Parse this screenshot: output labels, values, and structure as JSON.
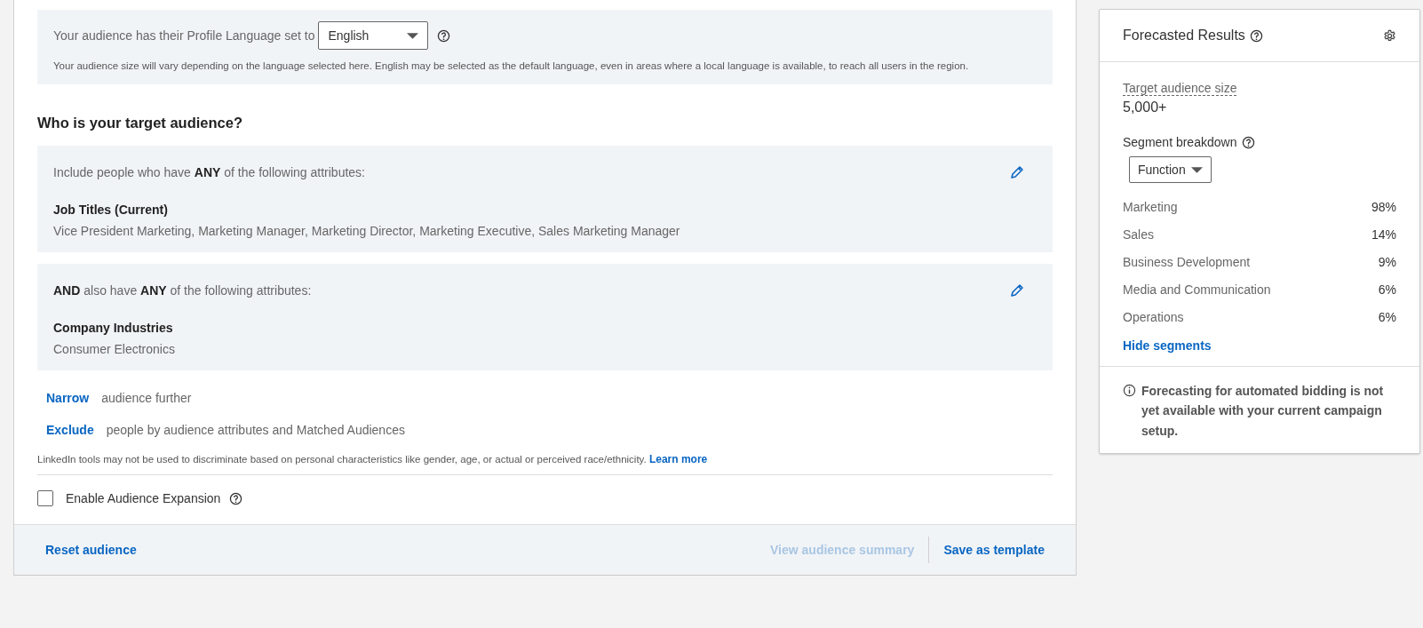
{
  "language": {
    "label": "Your audience has their Profile Language set to",
    "value": "English",
    "note": "Your audience size will vary depending on the language selected here. English may be selected as the default language, even in areas where a local language is available, to reach all users in the region."
  },
  "audience": {
    "heading": "Who is your target audience?",
    "groups": [
      {
        "intro": "Include people who have **ANY** of the following attributes:",
        "title": "Job Titles (Current)",
        "values": "Vice President Marketing, Marketing Manager, Marketing Director, Marketing Executive, Sales Marketing Manager"
      },
      {
        "intro": "**AND** also have **ANY** of the following attributes:",
        "title": "Company Industries",
        "values": "Consumer Electronics"
      }
    ],
    "actions": [
      {
        "link": "Narrow",
        "text": "audience further"
      },
      {
        "link": "Exclude",
        "text": "people by audience attributes and Matched Audiences"
      }
    ],
    "disclaimer": "LinkedIn tools may not be used to discriminate based on personal characteristics like gender, age, or actual or perceived race/ethnicity.",
    "disclaimer_link": "Learn more",
    "expansion": {
      "label": "Enable Audience Expansion",
      "checked": false
    }
  },
  "footer": {
    "reset": "Reset audience",
    "buttons": [
      {
        "label": "View audience summary",
        "disabled": true
      },
      {
        "label": "Save as template",
        "disabled": false
      }
    ]
  },
  "forecast": {
    "title": "Forecasted Results",
    "size_label": "Target audience size",
    "size_value": "5,000+",
    "breakdown_label": "Segment breakdown",
    "breakdown_value": "Function",
    "segments": [
      {
        "name": "Marketing",
        "share": "98%"
      },
      {
        "name": "Sales",
        "share": "14%"
      },
      {
        "name": "Business Development",
        "share": "9%"
      },
      {
        "name": "Media and Communication",
        "share": "6%"
      },
      {
        "name": "Operations",
        "share": "6%"
      }
    ],
    "hide_link": "Hide segments",
    "notice": "Forecasting for automated bidding is not yet available with your current campaign setup."
  }
}
